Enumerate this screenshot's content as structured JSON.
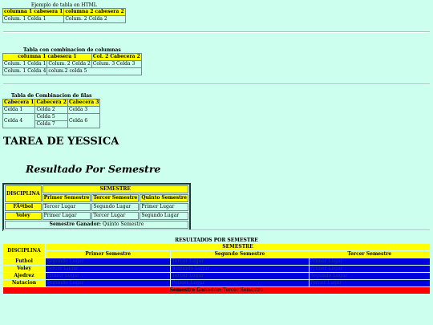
{
  "t1": {
    "caption": "Ejemplo de tabla en HTML",
    "headers": [
      "columna 1 cabesera 1",
      "columna 2 cabesera 2"
    ],
    "row": [
      "Colum. 1 Celda 1",
      "Colum. 2 Celda 2"
    ]
  },
  "t2": {
    "caption": "Tabla con combinacion de columnas",
    "headers": [
      "columna 1 cabesera 1",
      "Col. 2 Cabecera 2"
    ],
    "row1": [
      "Colum. 1 Celda 1",
      "Colum. 2 Celda 2",
      "Colum. 3 Celda 3"
    ],
    "row2": [
      "Colum. 1 Celda 4",
      "colum.2 celda 5"
    ]
  },
  "t3": {
    "caption": "Tabla de Combinacion de filas",
    "headers": [
      "Cabecera 1",
      "Cabecera 2",
      "Cabecera 3"
    ],
    "cells": [
      "Celda 1",
      "Celda 2",
      "Celda 3",
      "Celda 4",
      "Celda 5",
      "Celda 6",
      "Celda 7"
    ]
  },
  "title": "TAREA DE YESSICA",
  "subtitle": "Resultado Por Semestre",
  "t4": {
    "disciplina": "DISCIPLINA",
    "semestre": "SEMESTRE",
    "sems": [
      "Primer Semestre",
      "Tercer Semestre",
      "Quinto Semestre"
    ],
    "rows": [
      {
        "name": "FÃºtbol",
        "vals": [
          "Tercer Lugar",
          "Segundo Lugar",
          "Primer Lugar"
        ]
      },
      {
        "name": "Voley",
        "vals": [
          "Primer Lugar",
          "Tercer Lugar",
          "Segundo Lugar"
        ]
      }
    ],
    "footer_label": "Semestre Ganador:",
    "footer_value": "Quinto Semestre"
  },
  "t5": {
    "caption": "RESULTADOS POR SEMESTRE",
    "disciplina": "DISCIPLINA",
    "semestre": "SEMESTRE",
    "sems": [
      "Primer Semestre",
      "Segundo Semestre",
      "Tercer Semestre"
    ],
    "rows": [
      {
        "name": "Futbol",
        "vals": [
          "Segundo Lugar",
          "Tercer Lugar",
          "Primer Lugar"
        ]
      },
      {
        "name": "Voley",
        "vals": [
          "Tercer Lugar",
          "Segundo Lugar",
          "Primer Lugar"
        ]
      },
      {
        "name": "Ajedrez",
        "vals": [
          "Primer Lugar",
          "Tercer Lugar",
          "Segundo Lugar"
        ]
      },
      {
        "name": "Natacion",
        "vals": [
          "Segundo Lugar",
          "Primer Lugar",
          "Tercer Lugar"
        ]
      }
    ],
    "footer_label": "Semestre Ganador:",
    "footer_value": "Tercer Semestre"
  },
  "colors": {
    "background": "#ccffee",
    "header": "#ffff00",
    "blue": "#0000dd",
    "red": "#ff0000"
  }
}
